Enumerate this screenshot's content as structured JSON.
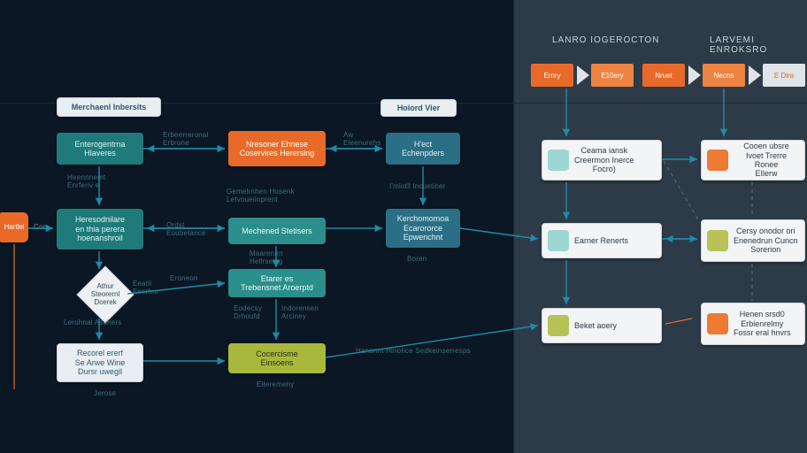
{
  "left": {
    "header1": "Merchaenl Inbersits",
    "header2": "Hoiord Vier",
    "boxes": {
      "n1": "Enterogentrna\nHlaveres",
      "n2": "Nresoner Ehnese\nCoservires Herersing",
      "n3": "H'ect\nEchenpders",
      "n4": "Heresodnilare\nen thia perera\nhoenanshroil",
      "n5": "Mechened Stetisers",
      "n6": "Kerchomomoa\nEcarororce\nEpwenchnt",
      "n7": "Etarer es\nTrebensnet Aroerptd",
      "n8": "Cocercisme\nEinsoens",
      "n9": "Recorel ererf\nSe Arwe Wine\nDursr uwegil",
      "start": "Hartlel",
      "diamond": "Athur\nSteorernl\nDcerek"
    },
    "labels": {
      "l1": "Erbeerreronal\nErbrone",
      "l2": "Hirennnemt\nEnrferiv e",
      "l3": "Gemelrnhen Hosenk\nLetvoueiinprent",
      "l4": "Ordst\nEoubetance",
      "l5": "Maarenirn\nHellrseing",
      "l6": "Eroneon",
      "l7": "Eeatil\nEecrhur",
      "l8": "Aw\nEleenurehs",
      "l9": "I'mlotll Incuetiner",
      "l10": "Boren",
      "l11": "Eodecsy\nDrhoufd",
      "l12": "Indorensen\nArciney",
      "l13": "Hanonnt Hlnohce Sedkeinserresps",
      "l14": "Elteremeny",
      "l15": "Lerohnal Asuhers",
      "l16": "Jerose"
    }
  },
  "right": {
    "header1": "Lanro Iogerocton",
    "header2": "Larvemi Enroksro",
    "steps": [
      "Ernry",
      "E10ery",
      "Nruet",
      "Necns",
      "E Dira"
    ],
    "cards": {
      "c1": "Ceama iansk\nCreermon Inerce\nFocro)",
      "c2": "Cooen ubsre\nIvoet Trerre Ronee\nEIlerw",
      "c3": "Earner Renerts",
      "c4": "Cersy onodor ori\nEnenedrun Cuncn\nSorerion",
      "c5": "Beket aoery",
      "c6": "Henen srsd0\nErbienrelmy\nFossr eral hnvrs"
    }
  }
}
